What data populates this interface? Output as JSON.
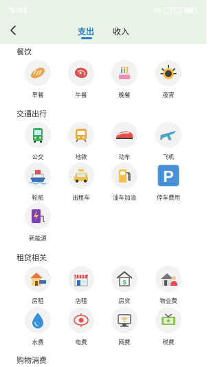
{
  "status_bar": {
    "time": "5:01",
    "network": "HD"
  },
  "tabs": {
    "expense": "支出",
    "income": "收入"
  },
  "sections": {
    "dining": {
      "title": "餐饮",
      "items": [
        {
          "label": "早餐",
          "icon": "bread-icon"
        },
        {
          "label": "午餐",
          "icon": "steak-icon"
        },
        {
          "label": "晚餐",
          "icon": "cake-icon"
        },
        {
          "label": "夜宵",
          "icon": "night-snack-icon"
        }
      ]
    },
    "transport": {
      "title": "交通出行",
      "items": [
        {
          "label": "公交",
          "icon": "bus-icon"
        },
        {
          "label": "地铁",
          "icon": "subway-icon"
        },
        {
          "label": "动车",
          "icon": "bullet-train-icon"
        },
        {
          "label": "飞机",
          "icon": "airplane-icon"
        },
        {
          "label": "轮船",
          "icon": "ship-icon"
        },
        {
          "label": "出租车",
          "icon": "taxi-icon"
        },
        {
          "label": "油车加油",
          "icon": "gas-pump-icon"
        },
        {
          "label": "停车费用",
          "icon": "parking-icon"
        },
        {
          "label": "新能源",
          "icon": "ev-battery-icon"
        }
      ]
    },
    "rent": {
      "title": "租贷相关",
      "items": [
        {
          "label": "房租",
          "icon": "house-rent-icon"
        },
        {
          "label": "店租",
          "icon": "shop-icon"
        },
        {
          "label": "房贷",
          "icon": "mortgage-icon"
        },
        {
          "label": "物业费",
          "icon": "property-icon"
        },
        {
          "label": "水费",
          "icon": "water-drop-icon"
        },
        {
          "label": "电费",
          "icon": "electricity-icon"
        },
        {
          "label": "网费",
          "icon": "internet-icon"
        },
        {
          "label": "税费",
          "icon": "tax-icon"
        }
      ]
    },
    "shopping": {
      "title": "购物消费"
    }
  }
}
